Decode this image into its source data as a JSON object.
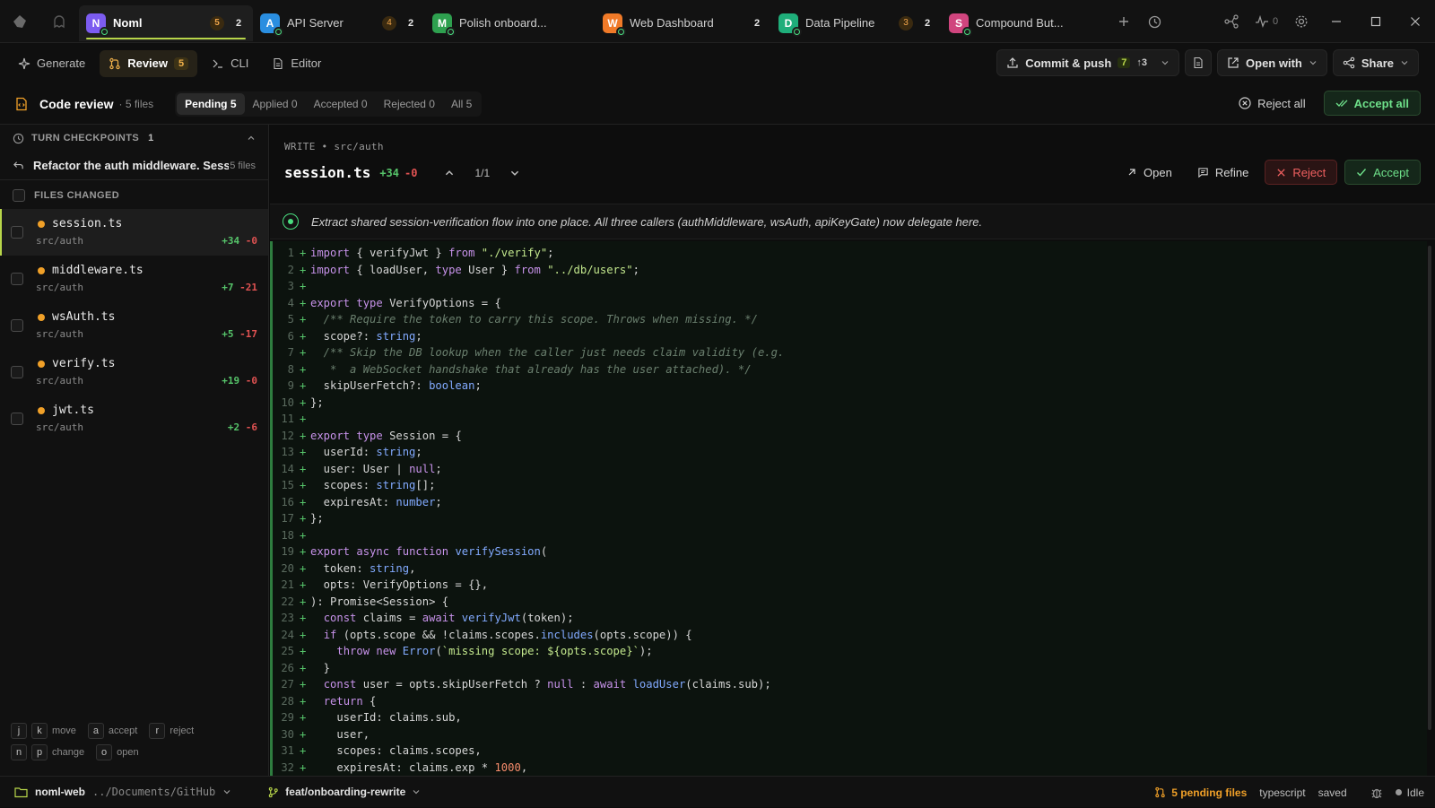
{
  "workspaces": [
    {
      "letter": "N",
      "name": "Noml",
      "color": "#7c5cf0",
      "badge": "5",
      "count": "2",
      "active": true
    },
    {
      "letter": "A",
      "name": "API Server",
      "color": "#2a8ee0",
      "badge": "4",
      "count": "2"
    },
    {
      "letter": "M",
      "name": "Polish onboard...",
      "color": "#2ea04f",
      "badge": "",
      "count": ""
    },
    {
      "letter": "W",
      "name": "Web Dashboard",
      "color": "#f07a28",
      "badge": "",
      "count": "2"
    },
    {
      "letter": "D",
      "name": "Data Pipeline",
      "color": "#1fae7a",
      "badge": "3",
      "count": "2"
    },
    {
      "letter": "S",
      "name": "Compound But...",
      "color": "#d0457e",
      "badge": "",
      "count": ""
    }
  ],
  "topbar": {
    "activity_count": "0"
  },
  "modes": {
    "generate": "Generate",
    "review": "Review",
    "review_count": "5",
    "cli": "CLI",
    "editor": "Editor"
  },
  "actions": {
    "commit_push": "Commit & push",
    "commit_count": "7",
    "commit_ahead": "↑3",
    "open_with": "Open with",
    "share": "Share"
  },
  "review": {
    "title": "Code review",
    "files": "· 5 files",
    "filters": [
      {
        "label": "Pending 5",
        "active": true
      },
      {
        "label": "Applied 0"
      },
      {
        "label": "Accepted 0"
      },
      {
        "label": "Rejected 0"
      },
      {
        "label": "All 5"
      }
    ],
    "reject_all": "Reject all",
    "accept_all": "Accept all"
  },
  "sidebar": {
    "checkpoints_label": "TURN CHECKPOINTS",
    "checkpoints_count": "1",
    "checkpoint_title": "Refactor the auth middleware. Sessi...",
    "checkpoint_files": "5 files",
    "files_changed_label": "FILES CHANGED",
    "files": [
      {
        "name": "session.ts",
        "path": "src/auth",
        "add": "+34",
        "del": "-0",
        "selected": true
      },
      {
        "name": "middleware.ts",
        "path": "src/auth",
        "add": "+7",
        "del": "-21"
      },
      {
        "name": "wsAuth.ts",
        "path": "src/auth",
        "add": "+5",
        "del": "-17"
      },
      {
        "name": "verify.ts",
        "path": "src/auth",
        "add": "+19",
        "del": "-0"
      },
      {
        "name": "jwt.ts",
        "path": "src/auth",
        "add": "+2",
        "del": "-6"
      }
    ],
    "shortcuts": {
      "k_j": "j",
      "k_k": "k",
      "move": "move",
      "k_a": "a",
      "accept": "accept",
      "k_r": "r",
      "reject": "reject",
      "k_n": "n",
      "k_p": "p",
      "change": "change",
      "k_o": "o",
      "open": "open"
    }
  },
  "main": {
    "crumb": "WRITE  •  src/auth",
    "filename": "session.ts",
    "add": "+34",
    "del": "-0",
    "hunk": "1/1",
    "open": "Open",
    "refine": "Refine",
    "reject": "Reject",
    "accept": "Accept",
    "summary": "Extract shared session-verification flow into one place. All three callers (authMiddleware, wsAuth, apiKeyGate) now delegate here."
  },
  "code_lines": [
    "import { verifyJwt } from \"./verify\";",
    "import { loadUser, type User } from \"../db/users\";",
    "",
    "export type VerifyOptions = {",
    "  /** Require the token to carry this scope. Throws when missing. */",
    "  scope?: string;",
    "  /** Skip the DB lookup when the caller just needs claim validity (e.g.",
    "   *  a WebSocket handshake that already has the user attached). */",
    "  skipUserFetch?: boolean;",
    "};",
    "",
    "export type Session = {",
    "  userId: string;",
    "  user: User | null;",
    "  scopes: string[];",
    "  expiresAt: number;",
    "};",
    "",
    "export async function verifySession(",
    "  token: string,",
    "  opts: VerifyOptions = {},",
    "): Promise<Session> {",
    "  const claims = await verifyJwt(token);",
    "  if (opts.scope && !claims.scopes.includes(opts.scope)) {",
    "    throw new Error(`missing scope: ${opts.scope}`);",
    "  }",
    "  const user = opts.skipUserFetch ? null : await loadUser(claims.sub);",
    "  return {",
    "    userId: claims.sub,",
    "    user,",
    "    scopes: claims.scopes,",
    "    expiresAt: claims.exp * 1000,"
  ],
  "status": {
    "project": "noml-web",
    "path": "../Documents/GitHub",
    "branch": "feat/onboarding-rewrite",
    "pending": "5 pending files",
    "lang": "typescript",
    "saved": "saved",
    "idle": "Idle"
  }
}
